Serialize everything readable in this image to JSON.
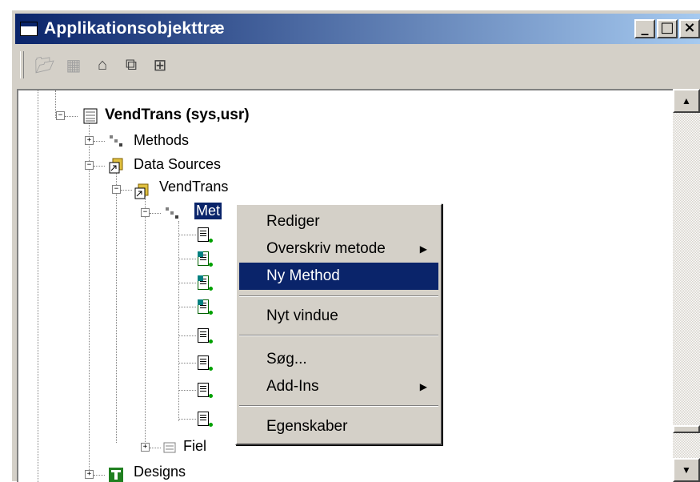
{
  "window": {
    "title": "Applikationsobjekttræ",
    "controls": [
      "_",
      "□",
      "×"
    ]
  },
  "toolbar": {
    "icons": [
      "open-icon",
      "save-icon",
      "properties-icon",
      "copy-icon",
      "compare-icon"
    ]
  },
  "tree": {
    "root": "VendTrans (sys,usr)",
    "methods": "Methods",
    "data_sources": "Data Sources",
    "ds_vendtrans": "VendTrans",
    "ds_methods_selected": "Met",
    "fields": "Fiel",
    "designs": "Designs",
    "method_node_count": 8
  },
  "context_menu": {
    "edit": "Rediger",
    "override": "Overskriv metode",
    "new_method": "Ny Method",
    "new_window": "Nyt vindue",
    "search": "Søg...",
    "addins": "Add-Ins",
    "properties": "Egenskaber"
  },
  "colors": {
    "titlebar": "#0a246a",
    "face": "#d4d0c8",
    "highlight": "#0a246a"
  }
}
